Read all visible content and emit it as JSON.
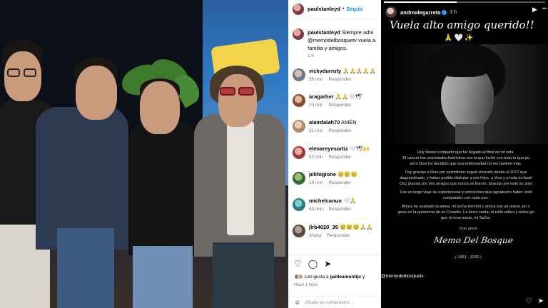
{
  "post": {
    "username": "paulstanleyd",
    "follow_label": "Seguir",
    "caption_lines": [
      "Siempre adm",
      "@memodelbosquetv vuela a",
      "familia y amigos."
    ],
    "caption_time": "1 h",
    "reply_label": "Responder",
    "comments": [
      {
        "user": "vickydurruty",
        "text": "🙏🙏🙏🙏🙏",
        "time": "56 min"
      },
      {
        "user": "aragarher",
        "text": "🙏🙏🤍🕊",
        "time": "23 min"
      },
      {
        "user": "alairdalah70",
        "text": "AMÉN",
        "time": "31 min"
      },
      {
        "user": "elenareyesortiz",
        "text": "🤍🕊🙌",
        "time": "52 min"
      },
      {
        "user": "pilifogione",
        "text": "😢😢😢",
        "time": "19 min"
      },
      {
        "user": "michelcanun",
        "text": "🤍🙏",
        "time": "54 min"
      },
      {
        "user": "jlrb4020_35",
        "text": "😢😢😢🙏🙏",
        "time": "Ahora"
      }
    ],
    "likes_prefix": "Les gusta a",
    "likes_user": "galileamontijo",
    "likes_and": "y",
    "tag_overflow": "@memodelbosquetv",
    "likes_time": "Hace 1 hora",
    "add_comment_placeholder": "Añade un comentario..."
  },
  "story": {
    "username": "andrealegarreta",
    "time": "3 h",
    "title": "Vuela alto amigo querido!!",
    "emoji": "🙏🤍✨",
    "progress": 0.45,
    "message_lines": [
      "Hoy deseo compartir que he llegado al final de mi vida.",
      "El cancer fue una batalla fuertísima con la que luché con todo lo que pu",
      "pero Dios ha decidido que esa enfermedad no me lastime más.",
      "",
      "Doy gracias a Dios por permitirme seguir viviendo desde el 2017 que",
      "diagnosticado, y haber podido disfrutar a mis hijos, a Vica y a toda mi famil",
      "Doy gracias por mis amigos que nunca se fueron. Gracias por todo su amo",
      "",
      "Fue un largo viaje de experiencias y emociones que agradezco haber vivid",
      "compartido con cada uno.",
      "",
      "Ahora he acabado la pelea, mi lucha terminó y ahora soy un nuevo ser c",
      "goza en la presencia de su Creador. La tierra canta, el cielo adora y todos gri",
      "que tú eres santo, mi Señor."
    ],
    "sign_label": "Con amor",
    "signature": "Memo Del Bosque",
    "years": "( 1961 - 2025 )"
  },
  "icons": {
    "heart": "♡",
    "comment": "◯",
    "share": "➤",
    "play": "▶",
    "more": "•••",
    "emoji": "☺",
    "send": "➤"
  }
}
